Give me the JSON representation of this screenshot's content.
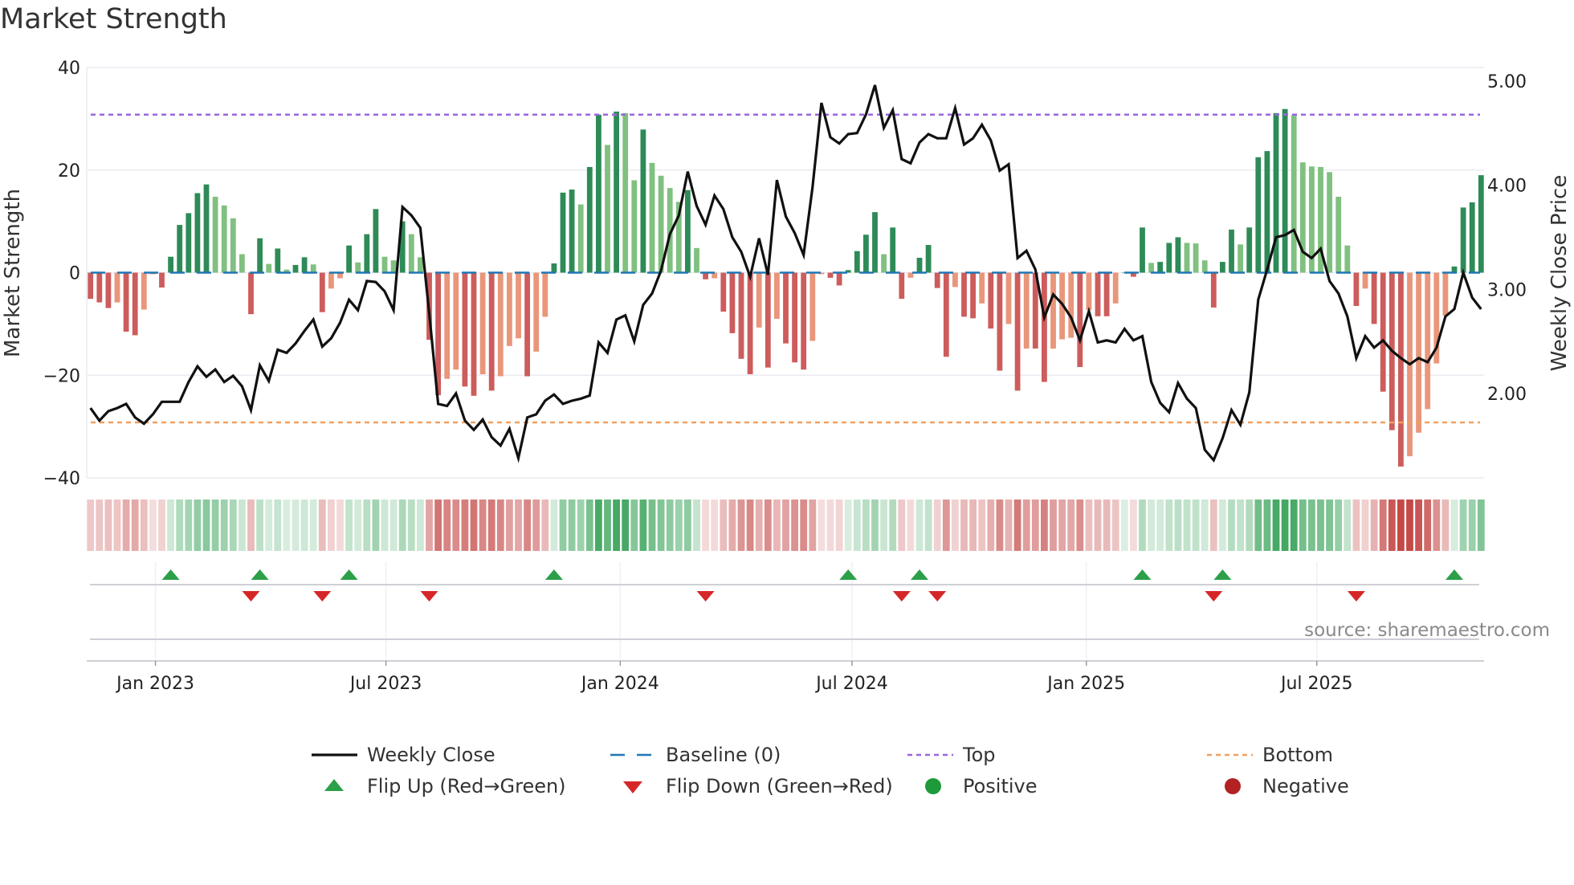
{
  "title": "Market Strength",
  "source": "source: sharemaestro.com",
  "chart_data": {
    "type": "bar",
    "title": "Market Strength",
    "ylabel": "Market Strength",
    "y2label": "Weekly Close Price",
    "ylim": [
      -40,
      40
    ],
    "y2lim": [
      1.19,
      5.13
    ],
    "yticks": [
      {
        "value": 40,
        "label": "40"
      },
      {
        "value": 20,
        "label": "20"
      },
      {
        "value": 0,
        "label": "0"
      },
      {
        "value": -20,
        "label": "−20"
      },
      {
        "value": -40,
        "label": "−40"
      }
    ],
    "y2ticks": [
      {
        "value": 5,
        "label": "5.00"
      },
      {
        "value": 4,
        "label": "4.00"
      },
      {
        "value": 3,
        "label": "3.00"
      },
      {
        "value": 2,
        "label": "2.00"
      }
    ],
    "xticks": [
      {
        "label": "Jan 2023",
        "date": "2023-01-01"
      },
      {
        "label": "Jul 2023",
        "date": "2023-07-01"
      },
      {
        "label": "Jan 2024",
        "date": "2024-01-01"
      },
      {
        "label": "Jul 2024",
        "date": "2024-07-01"
      },
      {
        "label": "Jan 2025",
        "date": "2025-01-01"
      },
      {
        "label": "Jul 2025",
        "date": "2025-07-01"
      }
    ],
    "x_start": "2022-11-11",
    "x_freq": "weekly",
    "grid": true,
    "top": 30.8,
    "bottom": -29.2,
    "baseline": 0,
    "strength": [
      -5.1,
      -5.8,
      -6.9,
      -5.8,
      -11.5,
      -12.2,
      -7.2,
      -0.3,
      -2.9,
      3.1,
      9.3,
      11.6,
      15.5,
      17.2,
      14.8,
      13.1,
      10.6,
      3.6,
      -8.1,
      6.7,
      1.7,
      4.7,
      0.6,
      1.5,
      3.0,
      1.6,
      -7.7,
      -3.1,
      -1.1,
      5.3,
      2.0,
      7.5,
      12.4,
      3.1,
      2.4,
      10.0,
      7.5,
      3.0,
      -13.1,
      -23.9,
      -20.7,
      -18.9,
      -22.2,
      -24.0,
      -19.8,
      -23.0,
      -20.2,
      -14.3,
      -12.8,
      -20.2,
      -15.4,
      -8.6,
      1.8,
      15.6,
      16.2,
      13.3,
      20.6,
      30.8,
      24.9,
      31.4,
      31.1,
      18.0,
      27.9,
      21.4,
      18.9,
      16.5,
      13.8,
      16.1,
      4.8,
      -1.3,
      -1.1,
      -7.6,
      -11.8,
      -16.8,
      -19.8,
      -10.7,
      -18.5,
      -9.0,
      -13.8,
      -17.5,
      -18.9,
      -13.3,
      -0.3,
      -1.0,
      -2.5,
      0.5,
      4.2,
      7.4,
      11.8,
      3.6,
      8.8,
      -5.1,
      -1.0,
      2.9,
      5.4,
      -3.0,
      -16.4,
      -2.8,
      -8.6,
      -8.9,
      -6.0,
      -10.9,
      -19.1,
      -10.0,
      -23.0,
      -14.8,
      -14.8,
      -21.3,
      -14.8,
      -13.0,
      -12.7,
      -18.4,
      -7.3,
      -8.5,
      -8.5,
      -6.0,
      0,
      -0.8,
      8.8,
      1.9,
      2.1,
      5.8,
      6.9,
      5.8,
      5.7,
      2.4,
      -6.8,
      2.1,
      8.4,
      5.5,
      8.8,
      22.5,
      23.7,
      31.1,
      31.9,
      30.7,
      21.5,
      20.7,
      20.6,
      19.6,
      14.8,
      5.3,
      -6.5,
      -3.1,
      -10.0,
      -23.2,
      -30.7,
      -37.8,
      -35.8,
      -31.2,
      -26.6,
      -17.7,
      -8.4,
      1.2,
      12.7,
      13.7,
      19.0
    ],
    "weekly_close": [
      1.86,
      1.74,
      1.83,
      1.86,
      1.9,
      1.77,
      1.71,
      1.8,
      1.92,
      1.92,
      1.92,
      2.11,
      2.26,
      2.16,
      2.23,
      2.11,
      2.17,
      2.07,
      1.84,
      2.27,
      2.12,
      2.42,
      2.39,
      2.48,
      2.6,
      2.71,
      2.45,
      2.53,
      2.68,
      2.9,
      2.8,
      3.08,
      3.07,
      2.98,
      2.8,
      3.79,
      3.71,
      3.59,
      2.77,
      1.9,
      1.88,
      2.0,
      1.74,
      1.65,
      1.75,
      1.58,
      1.5,
      1.66,
      1.38,
      1.77,
      1.8,
      1.93,
      1.99,
      1.9,
      1.93,
      1.95,
      1.98,
      2.49,
      2.39,
      2.71,
      2.75,
      2.5,
      2.85,
      2.96,
      3.18,
      3.53,
      3.71,
      4.13,
      3.8,
      3.62,
      3.9,
      3.77,
      3.5,
      3.36,
      3.12,
      3.49,
      3.14,
      4.05,
      3.7,
      3.54,
      3.33,
      3.98,
      4.79,
      4.46,
      4.4,
      4.49,
      4.5,
      4.68,
      4.96,
      4.55,
      4.72,
      4.25,
      4.21,
      4.41,
      4.49,
      4.45,
      4.45,
      4.74,
      4.39,
      4.45,
      4.58,
      4.43,
      4.14,
      4.2,
      3.3,
      3.37,
      3.19,
      2.73,
      2.95,
      2.86,
      2.73,
      2.51,
      2.79,
      2.49,
      2.51,
      2.49,
      2.62,
      2.51,
      2.55,
      2.11,
      1.91,
      1.82,
      2.1,
      1.95,
      1.86,
      1.46,
      1.36,
      1.57,
      1.84,
      1.7,
      2.01,
      2.9,
      3.19,
      3.5,
      3.52,
      3.57,
      3.36,
      3.3,
      3.39,
      3.08,
      2.96,
      2.74,
      2.34,
      2.55,
      2.44,
      2.51,
      2.41,
      2.34,
      2.28,
      2.34,
      2.3,
      2.44,
      2.74,
      2.81,
      3.16,
      2.92,
      2.81
    ],
    "colors": {
      "pos_strong": "#2e8b57",
      "pos_weak": "#80c080",
      "neg_strong": "#cd5c5c",
      "neg_weak": "#e9967a",
      "baseline": "#1f77b4",
      "top": "#9966e0",
      "bottom": "#f0a060",
      "close": "#111111",
      "flip_up": "#2ca048",
      "flip_down": "#d62728",
      "positive": "#1e9a3a",
      "negative": "#b22222"
    },
    "legend_position": "bottom",
    "legend": [
      {
        "label": "Weekly Close",
        "kind": "line"
      },
      {
        "label": "Baseline (0)",
        "kind": "dash"
      },
      {
        "label": "Top",
        "kind": "dot-top"
      },
      {
        "label": "Bottom",
        "kind": "dot-bottom"
      },
      {
        "label": "Flip Up (Red→Green)",
        "kind": "tri-up"
      },
      {
        "label": "Flip Down (Green→Red)",
        "kind": "tri-down"
      },
      {
        "label": "Positive",
        "kind": "dot-pos"
      },
      {
        "label": "Negative",
        "kind": "dot-neg"
      }
    ]
  }
}
